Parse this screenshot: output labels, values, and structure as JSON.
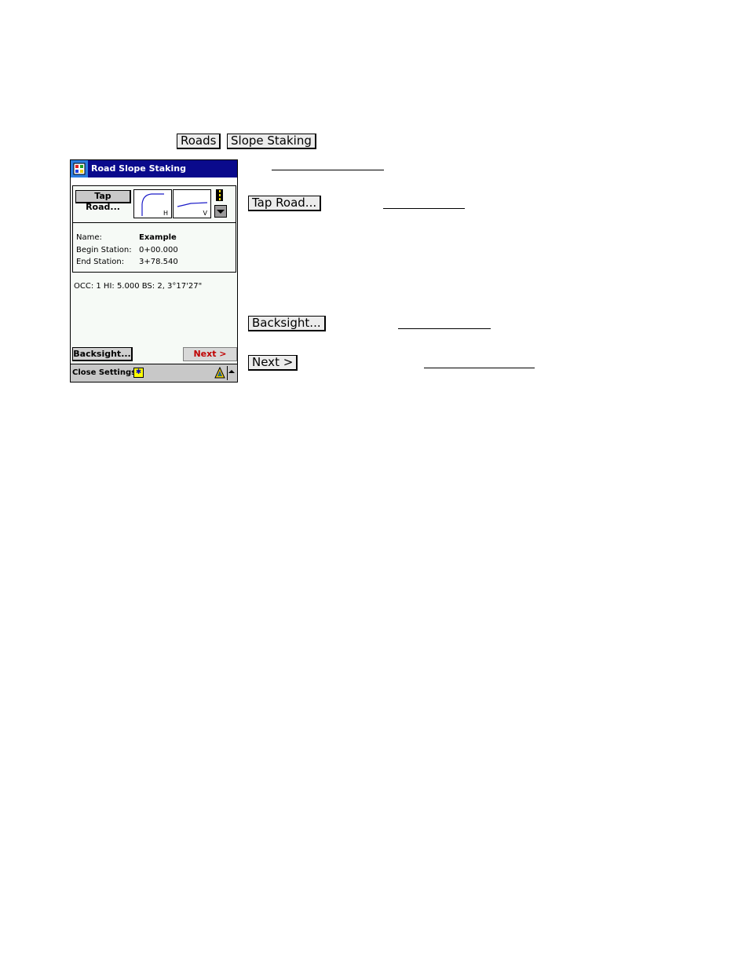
{
  "doc": {
    "menu_buttons": [
      "Roads",
      "Slope Staking"
    ],
    "side_buttons": {
      "tap_road": "Tap Road...",
      "backsight": "Backsight...",
      "next": "Next >"
    }
  },
  "device": {
    "title": "Road Slope Staking",
    "tap_road_label": "Tap Road...",
    "preview_labels": {
      "horizontal": "H",
      "vertical": "V"
    },
    "road_info": {
      "name_label": "Name:",
      "name_value": "Example",
      "begin_label": "Begin Station:",
      "begin_value": "0+00.000",
      "end_label": "End Station:",
      "end_value": "3+78.540"
    },
    "status_line": "OCC: 1  HI: 5.000  BS: 2, 3°17'27\"",
    "backsight_label": "Backsight...",
    "next_label": "Next >",
    "command_bar": {
      "label": "Close Settings"
    },
    "colors": {
      "titlebar": "#0a0a8c",
      "next_text": "#c00000"
    }
  }
}
